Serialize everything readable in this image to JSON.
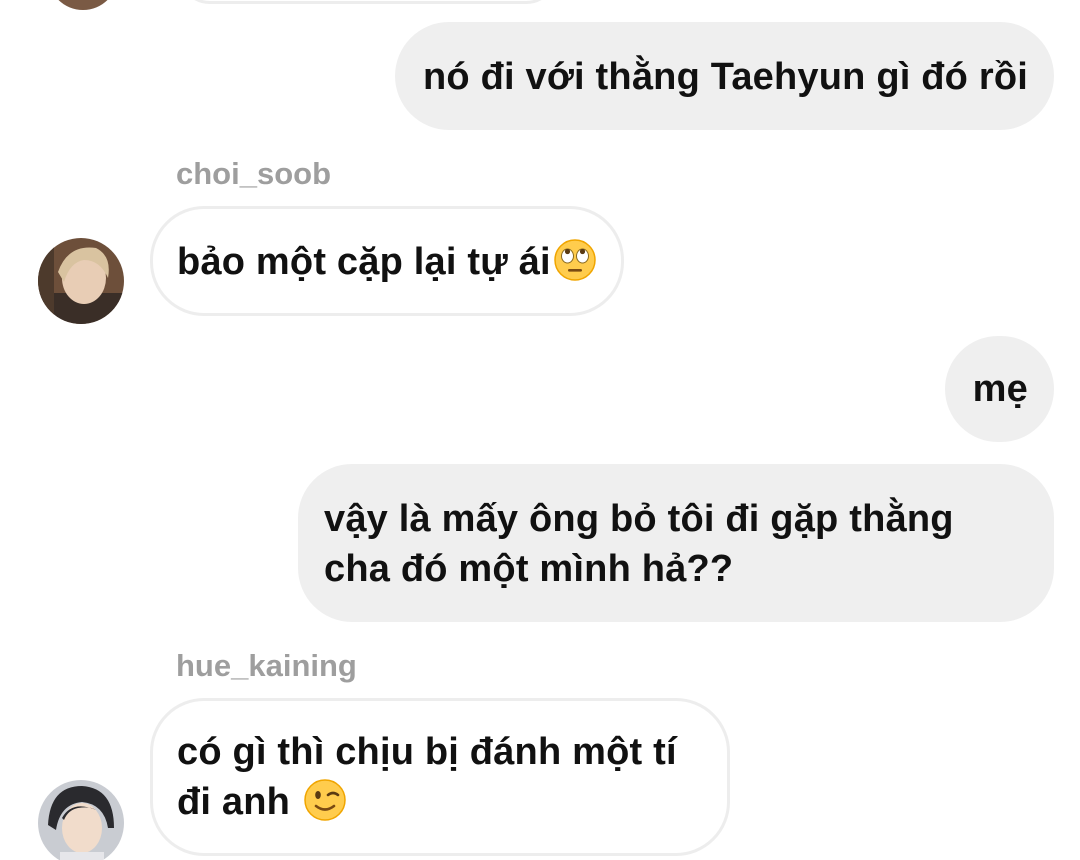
{
  "messages": {
    "m1": {
      "text": "nó đi với thằng Taehyun gì đó rồi"
    },
    "m2": {
      "username": "choi_soob",
      "text": "bảo một cặp lại tự ái",
      "emoji": "face-with-rolling-eyes-icon"
    },
    "m3": {
      "text": "mẹ"
    },
    "m4": {
      "line1": "vậy là mấy ông bỏ tôi đi gặp thằng",
      "line2": "cha đó một mình hả??"
    },
    "m5": {
      "username": "hue_kaining",
      "line1": "có gì thì chịu bị đánh một tí",
      "line2": "đi anh",
      "emoji": "winking-face-icon"
    }
  },
  "colors": {
    "outgoing_bubble": "#efefef",
    "incoming_border": "#ededed",
    "username": "#9e9e9e",
    "text": "#111111"
  }
}
